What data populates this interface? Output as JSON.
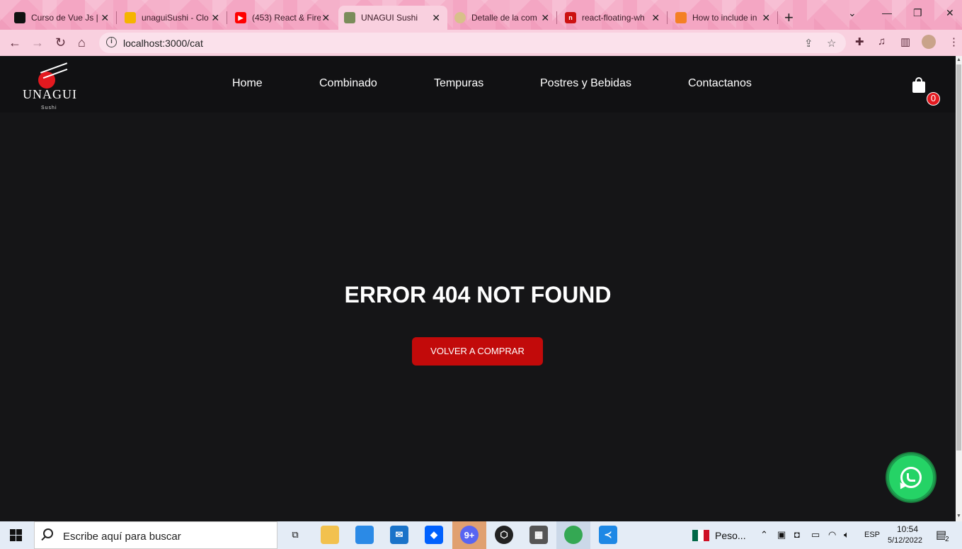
{
  "browser": {
    "tabs": [
      {
        "title": "Curso de Vue Js |",
        "favicon_color": "#111111",
        "active": false
      },
      {
        "title": "unaguiSushi - Clo",
        "favicon_color": "#f5b400",
        "active": false
      },
      {
        "title": "(453) React & Fire",
        "favicon_color": "#ff0000",
        "active": false
      },
      {
        "title": "UNAGUI Sushi",
        "favicon_color": "#7a8c5a",
        "active": true
      },
      {
        "title": "Detalle de la com",
        "favicon_color": "#d8c08a",
        "active": false
      },
      {
        "title": "react-floating-wh",
        "favicon_color": "#cc1111",
        "active": false
      },
      {
        "title": "How to include in",
        "favicon_color": "#f48024",
        "active": false
      }
    ],
    "url": "localhost:3000/cat"
  },
  "site": {
    "logo": {
      "brand": "UNAGUI",
      "sub": "Sushi"
    },
    "nav": [
      "Home",
      "Combinado",
      "Tempuras",
      "Postres y Bebidas",
      "Contactanos"
    ],
    "cart_count": "0",
    "accent_color": "#c20a0a"
  },
  "main": {
    "error_title": "ERROR 404 NOT FOUND",
    "cta_label": "VOLVER A COMPRAR"
  },
  "taskbar": {
    "search_placeholder": "Escribe aquí para buscar",
    "currency_widget": "Peso...",
    "language": "ESP",
    "time": "10:54",
    "date": "5/12/2022",
    "notifications": "2"
  }
}
